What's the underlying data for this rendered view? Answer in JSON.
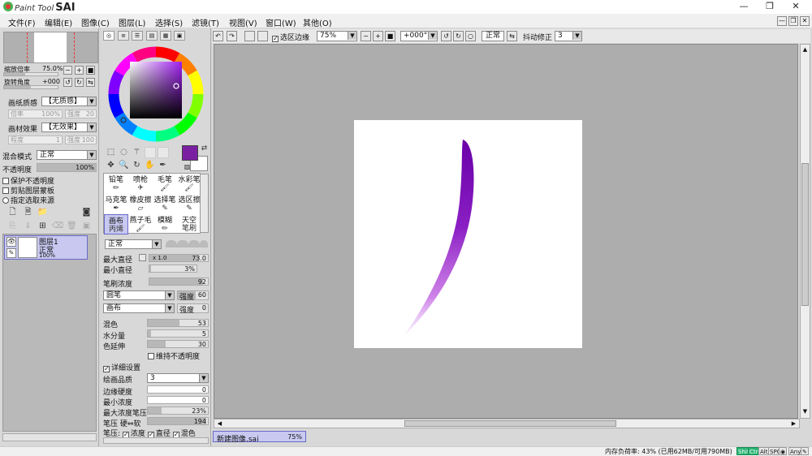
{
  "app": {
    "logo_small": "Paint Tool",
    "logo_big": "SAI"
  },
  "window_controls": [
    "—",
    "❐",
    "✕"
  ],
  "menu": [
    "文件(F)",
    "编辑(E)",
    "图像(C)",
    "图层(L)",
    "选择(S)",
    "滤镜(T)",
    "视图(V)",
    "窗口(W)",
    "其他(O)"
  ],
  "navigator": {
    "zoom_label": "缩放倍率",
    "zoom_value": "75.0%",
    "rotate_label": "旋转角度",
    "rotate_value": "+000"
  },
  "paper": {
    "texture_label": "画纸质感",
    "texture_value": "【无质感】",
    "texture_scale_label": "倍率",
    "texture_scale_value": "100%",
    "texture_strength_label": "强度",
    "texture_strength_value": "20",
    "effect_label": "画材效果",
    "effect_value": "【无效果】",
    "effect_width_label": "程度",
    "effect_width_value": "1",
    "effect_strength_label": "强度",
    "effect_strength_value": "100"
  },
  "layer_props": {
    "blend_label": "混合模式",
    "blend_value": "正常",
    "opacity_label": "不透明度",
    "opacity_value": "100%",
    "preserve_opacity": "保护不透明度",
    "clip_group": "剪贴图层蒙板",
    "selection_source": "指定选取来源"
  },
  "layers": [
    {
      "name": "图层1",
      "mode": "正常",
      "opacity": "100%"
    }
  ],
  "color": {
    "current": "#7b1fa2"
  },
  "tools": [
    {
      "label": "铅笔"
    },
    {
      "label": "喷枪"
    },
    {
      "label": "毛笔"
    },
    {
      "label": "水彩笔"
    },
    {
      "label": "马克笔"
    },
    {
      "label": "橡皮擦"
    },
    {
      "label": "选择笔"
    },
    {
      "label": "选区擦"
    },
    {
      "label": "画布"
    },
    {
      "label": "燕子毛"
    },
    {
      "label": "模糊"
    },
    {
      "label": "天空"
    }
  ],
  "tool_extra": {
    "selected_sub": "丙烯",
    "sky_sub": "笔刷"
  },
  "brush": {
    "blend_value": "正常",
    "max_size_label": "最大直径",
    "max_size_mult": "x 1.0",
    "max_size_value": "73.0",
    "min_size_label": "最小直径",
    "min_size_value": "3%",
    "density_label": "笔刷浓度",
    "density_value": "92",
    "shape_value": "圆笔",
    "shape_strength_label": "强度",
    "shape_strength_value": "60",
    "texture_value": "画布",
    "texture_strength_label": "强度",
    "texture_strength_value": "0",
    "blending_label": "混色",
    "blending_value": "53",
    "dilution_label": "水分量",
    "dilution_value": "5",
    "persistence_label": "色延伸",
    "persistence_value": "30",
    "keep_opacity": "维持不透明度",
    "advanced_label": "详细设置",
    "quality_label": "绘画品质",
    "quality_value": "3",
    "edge_label": "边缘硬度",
    "edge_value": "0",
    "min_density_label": "最小浓度",
    "min_density_value": "0",
    "max_pressure_label": "最大浓度笔压",
    "max_pressure_value": "23%",
    "pressure_label": "笔压 硬⇔软",
    "pressure_value": "194",
    "pressure_opts_label": "笔压:",
    "opt_density": "浓度",
    "opt_size": "直径",
    "opt_blend": "混色"
  },
  "canvas_toolbar": {
    "selection_edge": "选区边缘",
    "zoom": "75%",
    "angle": "+000°",
    "mode": "正常",
    "stabilizer_label": "抖动修正",
    "stabilizer_value": "3"
  },
  "file_tab": {
    "name": "新建图像.sai",
    "zoom": "75%"
  },
  "status": {
    "memory": "内存负荷率: 43% (已用62MB/可用790MB)",
    "keys": [
      "Shift",
      "Ctrl",
      "Alt",
      "SPC",
      "◉",
      "Any",
      "✎"
    ]
  }
}
